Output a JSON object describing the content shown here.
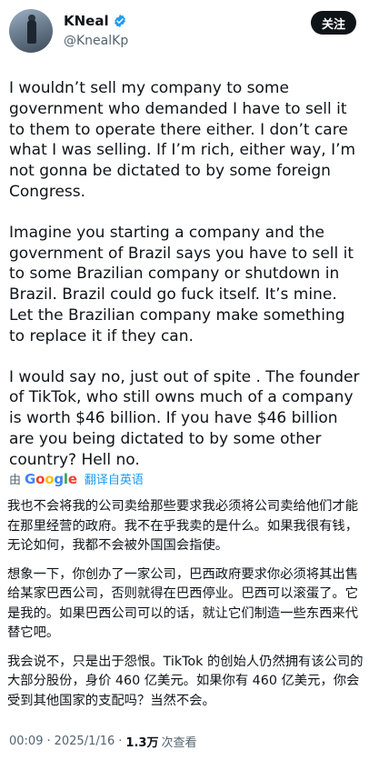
{
  "author": {
    "name": "KNeal",
    "handle": "@KnealKp",
    "follow_label": "关注"
  },
  "tweet": {
    "paragraphs": [
      "I wouldn’t sell my company to some government who demanded I have to sell it to them to operate there either. I don’t care what I was selling. If I’m rich, either way, I’m not gonna be dictated to by some foreign Congress.",
      "Imagine you starting a company and the government of Brazil says you have to sell it to some Brazilian company or shutdown in Brazil. Brazil could go fuck itself. It’s mine. Let the Brazilian company make something to replace it if they can.",
      "I would say no, just out of spite . The founder of TikTok, who still owns much of a company is worth $46 billion. If you have $46 billion are you being dictated to by some other country? Hell no."
    ]
  },
  "translation": {
    "by_label": "由",
    "provider": "Google",
    "link_label": "翻译自英语",
    "paragraphs": [
      "我也不会将我的公司卖给那些要求我必须将公司卖给他们才能在那里经营的政府。我不在乎我卖的是什么。如果我很有钱，无论如何，我都不会被外国国会指使。",
      "想象一下，你创办了一家公司，巴西政府要求你必须将其出售给某家巴西公司，否则就得在巴西停业。巴西可以滚蛋了。它是我的。如果巴西公司可以的话，就让它们制造一些东西来代替它吧。",
      "我会说不，只是出于怨恨。TikTok 的创始人仍然拥有该公司的大部分股份，身价 460 亿美元。如果你有 460 亿美元，你会受到其他国家的支配吗？当然不会。"
    ]
  },
  "meta": {
    "time": "00:09",
    "separator": "·",
    "date": "2025/1/16",
    "views_count": "1.3万",
    "views_label": "次查看"
  },
  "colors": {
    "verified": "#1d9bf0",
    "link": "#1d9bf0",
    "text": "#0f1419",
    "secondary": "#536471"
  }
}
